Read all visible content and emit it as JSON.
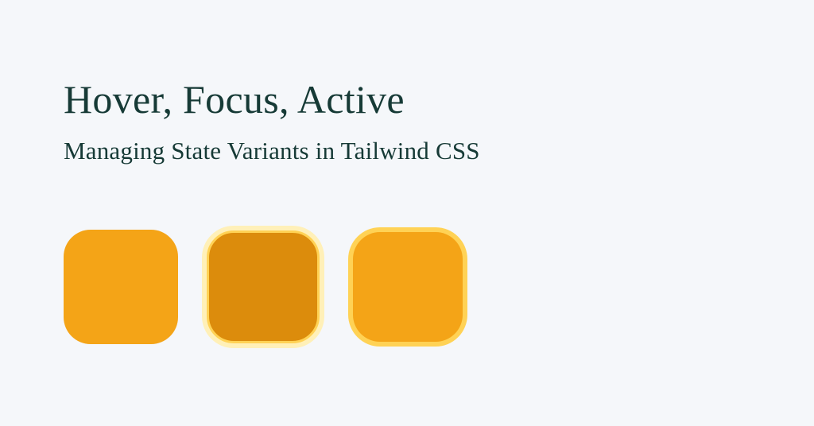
{
  "title": "Hover, Focus, Active",
  "subtitle": "Managing State Variants in Tailwind CSS",
  "swatches": {
    "normal": "#f4a417",
    "active": "#dc8c0c",
    "focus": "#f4a417",
    "ring_light": "#fff0b8",
    "ring_strong": "#ffd255"
  }
}
